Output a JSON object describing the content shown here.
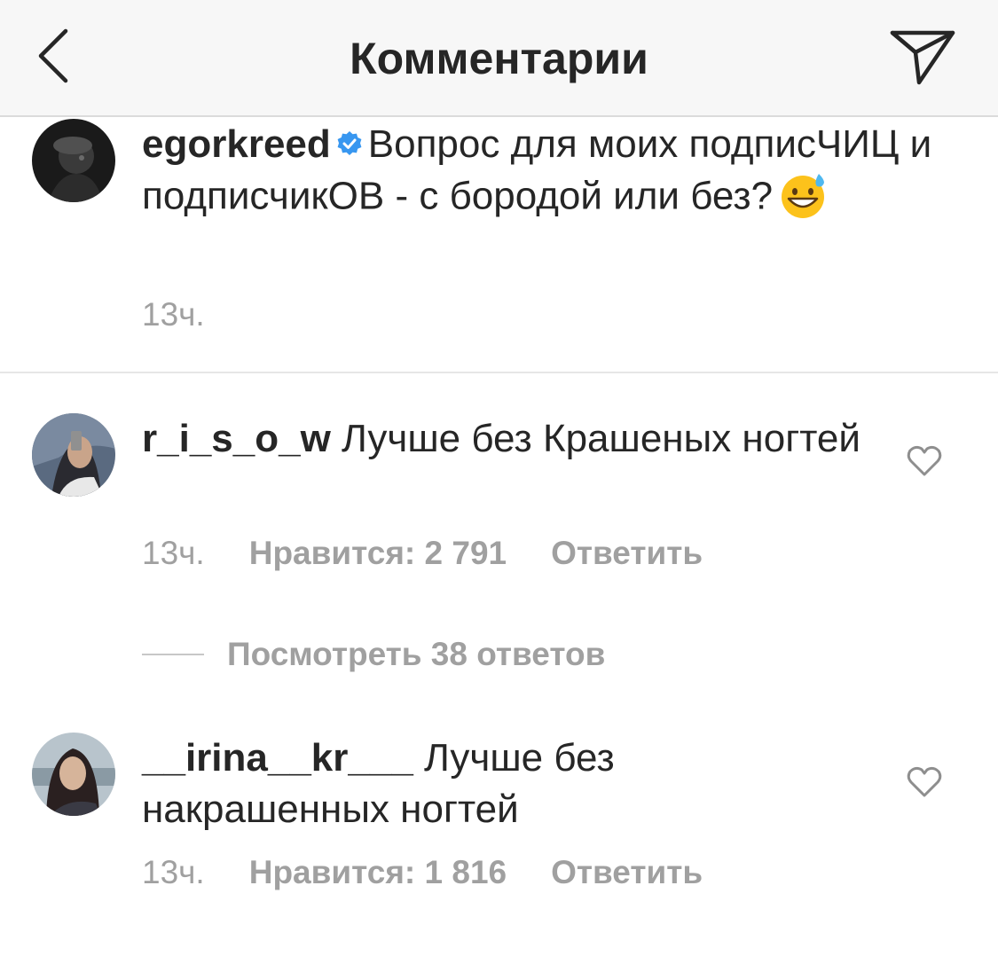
{
  "header": {
    "title": "Комментарии",
    "back_icon": "chevron-left-icon",
    "share_icon": "paper-plane-icon"
  },
  "caption": {
    "username": "egorkreed",
    "verified": true,
    "verified_color": "#3897f0",
    "text": "Вопрос для моих подписЧИЦ и подписчикОВ - с бородой или без?",
    "emoji": "😅",
    "time": "13ч."
  },
  "comments": [
    {
      "username": "r_i_s_o_w",
      "text": "Лучше без Крашеных ногтей",
      "time": "13ч.",
      "likes": "Нравится: 2 791",
      "reply": "Ответить",
      "view_replies": "Посмотреть 38 ответов"
    },
    {
      "username": "__irina__kr___",
      "text": "Лучше без накрашенных ногтей",
      "time": "13ч.",
      "likes": "Нравится: 1 816",
      "reply": "Ответить"
    }
  ],
  "colors": {
    "text": "#262626",
    "secondary": "#a0a0a0",
    "header_bg": "#f7f7f7"
  }
}
